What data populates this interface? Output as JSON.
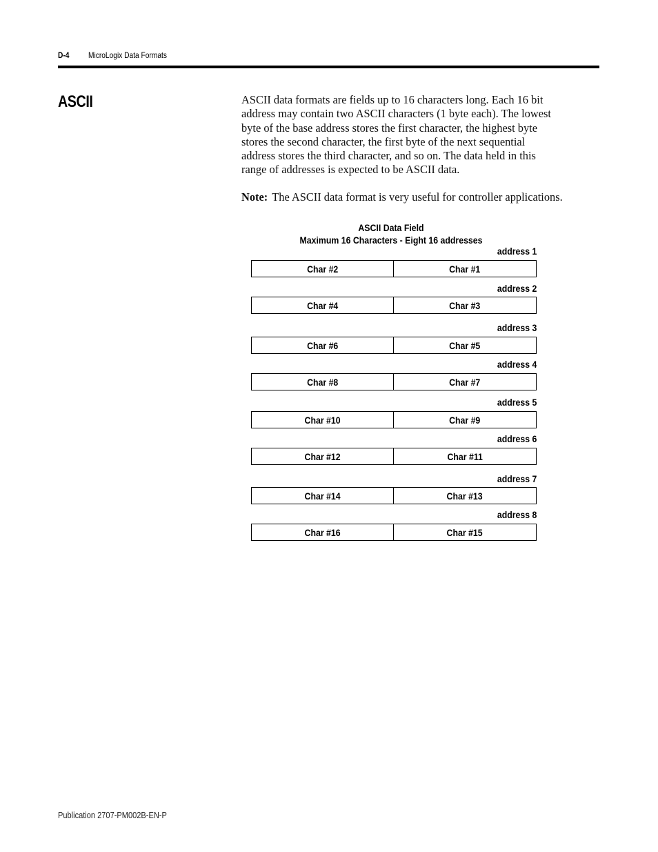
{
  "header": {
    "page_number": "D-4",
    "chapter_title": "MicroLogix Data Formats"
  },
  "section": {
    "title": "ASCII",
    "paragraph_lines": [
      "ASCII data formats are fields up to 16 characters long. Each 16 bit",
      "address may contain two ASCII characters (1 byte each).  The lowest",
      "byte of the base address stores the first character, the highest byte",
      "stores the second character, the first byte of the next sequential",
      "address stores the third character, and so on.  The data held in this",
      "range of addresses is expected to be ASCII data."
    ],
    "note_label": "Note:",
    "note_text": "The ASCII data format is very useful for controller applications."
  },
  "diagram": {
    "title": "ASCII Data Field",
    "subtitle": "Maximum 16 Characters - Eight 16 addresses",
    "words": [
      {
        "address": "address 1",
        "high": "Char #2",
        "low": "Char #1"
      },
      {
        "address": "address 2",
        "high": "Char #4",
        "low": "Char #3"
      },
      {
        "address": "address 3",
        "high": "Char #6",
        "low": "Char #5"
      },
      {
        "address": "address 4",
        "high": "Char #8",
        "low": "Char #7"
      },
      {
        "address": "address 5",
        "high": "Char #10",
        "low": "Char #9"
      },
      {
        "address": "address 6",
        "high": "Char #12",
        "low": "Char #11"
      },
      {
        "address": "address 7",
        "high": "Char #14",
        "low": "Char #13"
      },
      {
        "address": "address 8",
        "high": "Char #16",
        "low": "Char #15"
      }
    ]
  },
  "footer": {
    "publication": "Publication 2707-PM002B-EN-P"
  }
}
